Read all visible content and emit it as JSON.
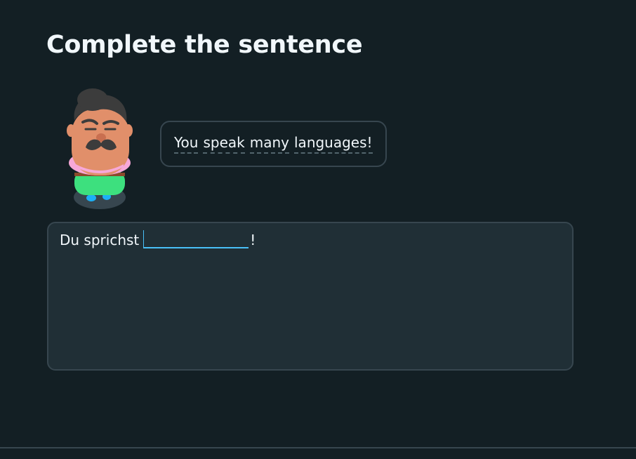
{
  "header": {
    "title": "Complete the sentence"
  },
  "prompt": {
    "character_icon": "cartoon-character-illustration",
    "bubble_words": [
      "You",
      "speak",
      "many",
      "languages!"
    ]
  },
  "answer": {
    "prefix": "Du sprichst",
    "blank_value": "",
    "suffix": "!"
  },
  "colors": {
    "background": "#131f24",
    "panel": "#202f36",
    "border": "#37464f",
    "accent_blue": "#49c0f8",
    "text": "#f1f7fb"
  }
}
